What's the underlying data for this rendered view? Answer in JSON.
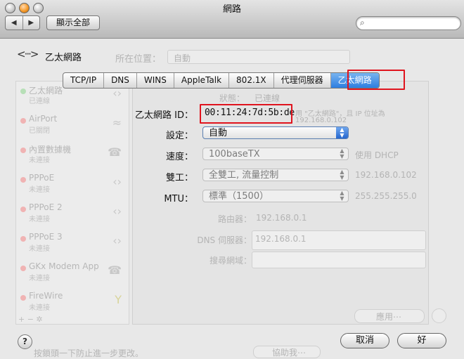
{
  "window": {
    "title": "網路"
  },
  "toolbar": {
    "back": "◀",
    "forward": "▶",
    "show_all": "顯示全部",
    "search_placeholder": ""
  },
  "network": {
    "icon": "<···>",
    "name": "乙太網路"
  },
  "background": {
    "location_label": "所在位置：",
    "location_value": "自動",
    "status_label": "狀態：",
    "status_value": "已連線",
    "status_note_1": "用 \"乙太網路\"，且 IP 位址為",
    "status_note_2": "192.168.0.102",
    "config_value": "使用 DHCP",
    "ip_value": "192.168.0.102",
    "mask_value": "255.255.255.0",
    "router_label": "路由器：",
    "router_value": "192.168.0.1",
    "dns_label": "DNS 伺服器：",
    "dns_value": "192.168.0.1",
    "search_domains_label": "搜尋網域：",
    "apply_label": "應用⋯",
    "bottom_note": "按鎖頭一下防止進一步更改。",
    "assist_label": "協助我⋯"
  },
  "sidebar": {
    "items": [
      {
        "name": "乙太網路",
        "sub": "已連線"
      },
      {
        "name": "AirPort",
        "sub": "已關閉"
      },
      {
        "name": "內置數據機",
        "sub": "未連接"
      },
      {
        "name": "PPPoE",
        "sub": "未連接"
      },
      {
        "name": "PPPoE 2",
        "sub": "未連接"
      },
      {
        "name": "PPPoE 3",
        "sub": "未連接"
      },
      {
        "name": "GKx Modem App",
        "sub": "未連接"
      },
      {
        "name": "FireWire",
        "sub": "未連接"
      }
    ],
    "footer": "+ − ✲"
  },
  "tabs": [
    "TCP/IP",
    "DNS",
    "WINS",
    "AppleTalk",
    "802.1X",
    "代理伺服器",
    "乙太網路"
  ],
  "form": {
    "id_label": "乙太網路 ID：",
    "id_value": "00:11:24:7d:5b:de",
    "config_label": "設定：",
    "config_value": "自動",
    "speed_label": "速度：",
    "speed_value": "100baseTX",
    "duplex_label": "雙工：",
    "duplex_value": "全雙工, 流量控制",
    "mtu_label": "MTU：",
    "mtu_value": "標準（1500）"
  },
  "footer": {
    "help": "?",
    "cancel": "取消",
    "ok": "好"
  }
}
